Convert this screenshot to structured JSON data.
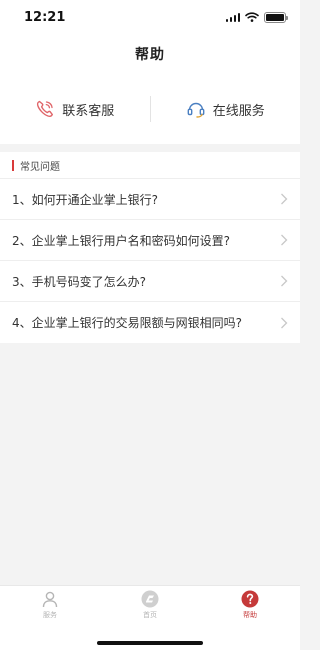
{
  "status_bar": {
    "time": "12:21"
  },
  "header": {
    "title": "帮助"
  },
  "contact": [
    {
      "label": "联系客服",
      "icon": "phone-icon",
      "color": "#e0666a"
    },
    {
      "label": "在线服务",
      "icon": "headset-icon",
      "color": "#4a7fc1"
    }
  ],
  "faq": {
    "title": "常见问题",
    "items": [
      "1、如何开通企业掌上银行?",
      "2、企业掌上银行用户名和密码如何设置?",
      "3、手机号码变了怎么办?",
      "4、企业掌上银行的交易限额与网银相同吗?"
    ]
  },
  "tabs": [
    {
      "label": "服务",
      "icon": "person-icon",
      "active": false
    },
    {
      "label": "首页",
      "icon": "home-logo-icon",
      "active": false
    },
    {
      "label": "帮助",
      "icon": "help-icon",
      "active": true
    }
  ],
  "colors": {
    "accent": "#d93a3a",
    "tab_inactive": "#b5b5b5",
    "background": "#f3f3f3"
  }
}
